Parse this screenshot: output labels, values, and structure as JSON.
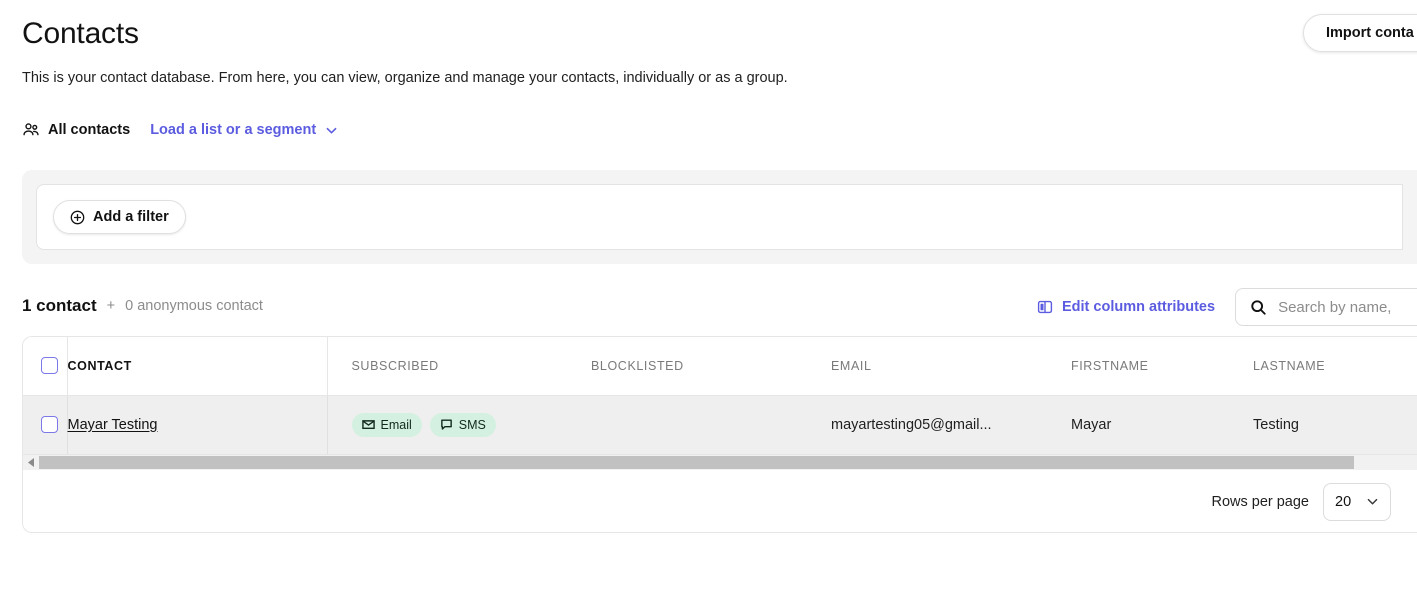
{
  "header": {
    "title": "Contacts",
    "subtitle": "This is your contact database. From here, you can view, organize and manage your contacts, individually or as a group.",
    "import_button": "Import conta",
    "accent_purple": "#5c5ce0"
  },
  "segment_bar": {
    "all_contacts_label": "All contacts",
    "load_list_label": "Load a list or a segment"
  },
  "filter": {
    "add_filter_label": "Add a filter"
  },
  "count": {
    "contacts": "1 contact",
    "separator": "+",
    "anonymous": "0 anonymous contact"
  },
  "toolbar": {
    "edit_columns_label": "Edit column attributes",
    "search_placeholder": "Search by name,",
    "search_value": ""
  },
  "table": {
    "columns": [
      "CONTACT",
      "SUBSCRIBED",
      "BLOCKLISTED",
      "EMAIL",
      "FIRSTNAME",
      "LASTNAME"
    ],
    "rows": [
      {
        "name": "Mayar Testing",
        "subscribed": [
          "Email",
          "SMS"
        ],
        "blocklisted": "",
        "email": "mayartesting05@gmail...",
        "firstname": "Mayar",
        "lastname": "Testing"
      }
    ],
    "badge_background": "#d3f0e0"
  },
  "footer": {
    "rows_per_page_label": "Rows per page",
    "rows_per_page_value": "20"
  }
}
